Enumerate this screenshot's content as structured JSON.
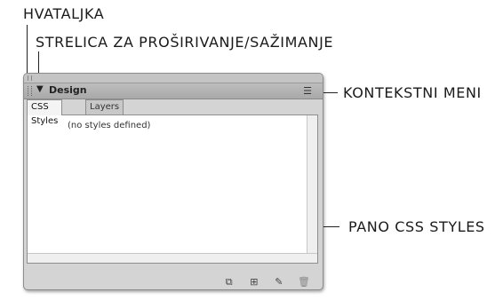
{
  "callouts": {
    "gripper": "HVATALJKA",
    "expand_collapse": "STRELICA ZA PROŠIRIVANJE/SAŽIMANJE",
    "context_menu": "KONTEKSTNI MENI",
    "css_styles_panel": "PANO CSS STYLES"
  },
  "panel": {
    "title": "Design",
    "tabs": [
      {
        "label": "CSS Styles",
        "active": true
      },
      {
        "label": "Layers",
        "active": false
      }
    ],
    "empty_message": "(no styles defined)",
    "icons": {
      "expand_arrow": "triangle-down-icon",
      "context_menu": "options-menu-icon",
      "bottom": [
        "attach-style-sheet-icon",
        "new-css-rule-icon",
        "edit-style-icon",
        "delete-icon"
      ]
    }
  }
}
